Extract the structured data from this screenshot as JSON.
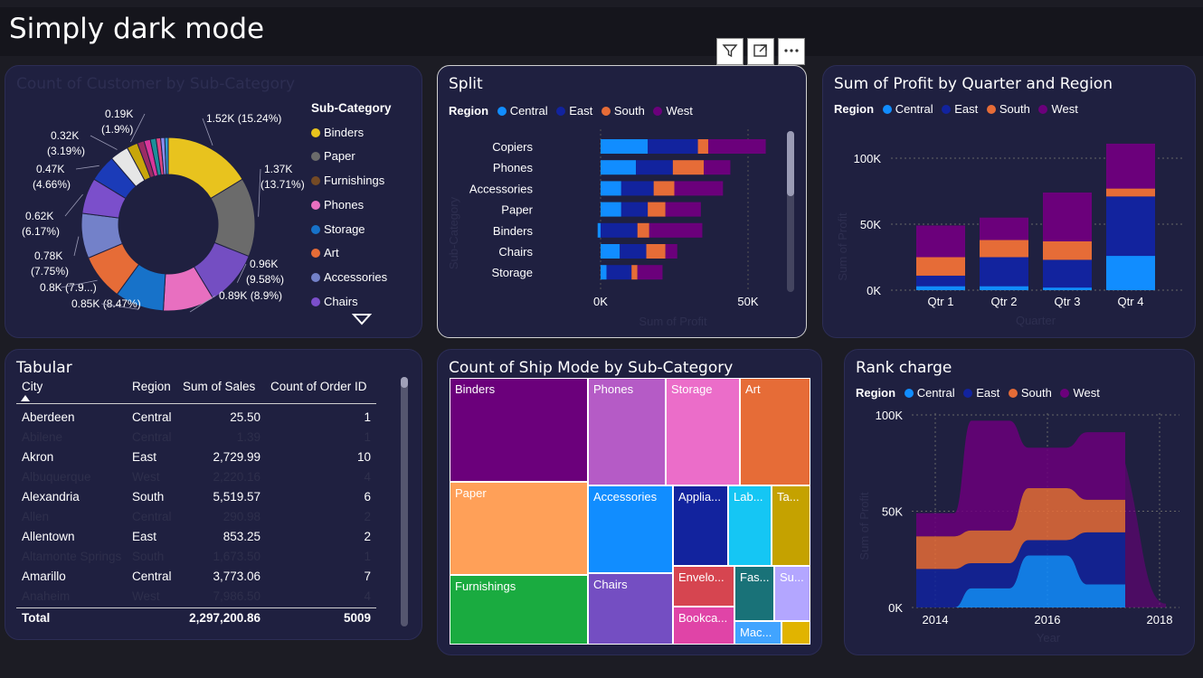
{
  "page": {
    "title": "Simply dark mode"
  },
  "toolbar": {
    "icons": [
      "filter-icon",
      "focus-mode-icon",
      "more-options-icon"
    ]
  },
  "colors": {
    "central": "#118DFF",
    "east": "#12239E",
    "south": "#E66C37",
    "west": "#6B007B"
  },
  "regions": [
    "Central",
    "East",
    "South",
    "West"
  ],
  "donut": {
    "title": "Count of Customer by Sub-Category",
    "legend_title": "Sub-Category",
    "legend_items": [
      "Binders",
      "Paper",
      "Furnishings",
      "Phones",
      "Storage",
      "Art",
      "Accessories",
      "Chairs"
    ],
    "labels": [
      {
        "l1": "1.52K (15.24%)",
        "l2": ""
      },
      {
        "l1": "1.37K",
        "l2": "(13.71%)"
      },
      {
        "l1": "0.96K",
        "l2": "(9.58%)"
      },
      {
        "l1": "0.89K (8.9%)",
        "l2": ""
      },
      {
        "l1": "0.85K (8.47%)",
        "l2": ""
      },
      {
        "l1": "0.8K (7.9...)",
        "l2": ""
      },
      {
        "l1": "0.78K",
        "l2": "(7.75%)"
      },
      {
        "l1": "0.62K",
        "l2": "(6.17%)"
      },
      {
        "l1": "0.47K",
        "l2": "(4.66%)"
      },
      {
        "l1": "0.32K",
        "l2": "(3.19%)"
      },
      {
        "l1": "0.19K",
        "l2": "(1.9%)"
      }
    ]
  },
  "split": {
    "title": "Split",
    "legend_title": "Region",
    "ylabel": "Sub-Category",
    "xlabel": "Sum of Profit",
    "xticks": [
      "0K",
      "50K"
    ]
  },
  "quarter": {
    "title": "Sum of Profit by Quarter and Region",
    "legend_title": "Region",
    "ylabel": "Sum of Profit",
    "xlabel": "Quarter",
    "yticks": [
      "0K",
      "50K",
      "100K"
    ]
  },
  "tabular": {
    "title": "Tabular",
    "headers": [
      "City",
      "Region",
      "Sum of Sales",
      "Count of Order ID"
    ],
    "rows": [
      {
        "city": "Aberdeen",
        "region": "Central",
        "sales": "25.50",
        "count": "1"
      },
      {
        "city": "Abilene",
        "region": "Central",
        "sales": "1.39",
        "count": "1"
      },
      {
        "city": "Akron",
        "region": "East",
        "sales": "2,729.99",
        "count": "10"
      },
      {
        "city": "Albuquerque",
        "region": "West",
        "sales": "2,220.16",
        "count": "4"
      },
      {
        "city": "Alexandria",
        "region": "South",
        "sales": "5,519.57",
        "count": "6"
      },
      {
        "city": "Allen",
        "region": "Central",
        "sales": "290.98",
        "count": "2"
      },
      {
        "city": "Allentown",
        "region": "East",
        "sales": "853.25",
        "count": "2"
      },
      {
        "city": "Altamonte Springs",
        "region": "South",
        "sales": "1,673.50",
        "count": "1"
      },
      {
        "city": "Amarillo",
        "region": "Central",
        "sales": "3,773.06",
        "count": "7"
      },
      {
        "city": "Anaheim",
        "region": "West",
        "sales": "7,986.50",
        "count": "4"
      }
    ],
    "total": {
      "label": "Total",
      "sales": "2,297,200.86",
      "count": "5009"
    }
  },
  "treemap": {
    "title": "Count of Ship Mode by Sub-Category",
    "tiles": [
      "Binders",
      "Paper",
      "Furnishings",
      "Phones",
      "Storage",
      "Art",
      "Accessories",
      "Chairs",
      "Applia...",
      "Lab...",
      "Ta...",
      "Envelo...",
      "Fas...",
      "Su...",
      "Bookca...",
      "Mac...",
      ""
    ]
  },
  "rank": {
    "title": "Rank charge",
    "legend_title": "Region",
    "ylabel": "Sum of Profit",
    "xlabel": "Year",
    "yticks": [
      "0K",
      "50K",
      "100K"
    ],
    "xticks": [
      "2014",
      "2016",
      "2018"
    ]
  },
  "chart_data": [
    {
      "type": "pie",
      "title": "Count of Customer by Sub-Category",
      "categories": [
        "Binders",
        "Paper",
        "Furnishings",
        "Phones",
        "Storage",
        "Art",
        "Accessories",
        "Chairs",
        "Labels",
        "Appliances",
        "Envelopes",
        "Bookcases",
        "Fasteners",
        "Supplies",
        "Machines",
        "Tables",
        "Copiers"
      ],
      "values": [
        1520,
        1370,
        960,
        890,
        850,
        800,
        780,
        620,
        470,
        320,
        190,
        120,
        110,
        100,
        80,
        70,
        60
      ],
      "colors": [
        "#E8C31E",
        "#6B6B6B",
        "#744EC2",
        "#E86FC0",
        "#1772C9",
        "#E66C37",
        "#7381C9",
        "#7B4FCB",
        "#1B3BB8",
        "#E6E6E6",
        "#C8A60A",
        "#9B2C64",
        "#D9369A",
        "#1C8F9A",
        "#E04884",
        "#8B8DF0",
        "#2E9BD6"
      ],
      "legend": "right"
    },
    {
      "type": "bar",
      "title": "Split",
      "orientation": "horizontal",
      "stacked": true,
      "categories": [
        "Copiers",
        "Phones",
        "Accessories",
        "Paper",
        "Binders",
        "Chairs",
        "Storage"
      ],
      "series": [
        {
          "name": "Central",
          "values": [
            16000,
            12000,
            7000,
            7000,
            -1000,
            6500,
            2000
          ]
        },
        {
          "name": "East",
          "values": [
            17000,
            12500,
            11000,
            9000,
            12500,
            9000,
            8500
          ]
        },
        {
          "name": "South",
          "values": [
            3500,
            10500,
            7000,
            6000,
            4000,
            6500,
            2000
          ]
        },
        {
          "name": "West",
          "values": [
            19500,
            9000,
            16500,
            12000,
            18000,
            4000,
            8500
          ]
        }
      ],
      "xlabel": "Sum of Profit",
      "ylabel": "Sub-Category",
      "xlim": [
        0,
        60000
      ],
      "legend": "top-left"
    },
    {
      "type": "bar",
      "title": "Sum of Profit by Quarter and Region",
      "stacked": true,
      "categories": [
        "Qtr 1",
        "Qtr 2",
        "Qtr 3",
        "Qtr 4"
      ],
      "series": [
        {
          "name": "Central",
          "values": [
            3000,
            3000,
            2000,
            26000
          ]
        },
        {
          "name": "East",
          "values": [
            8000,
            22000,
            21000,
            45000
          ]
        },
        {
          "name": "South",
          "values": [
            14000,
            13000,
            14000,
            6000
          ]
        },
        {
          "name": "West",
          "values": [
            24000,
            17000,
            37000,
            34000
          ]
        }
      ],
      "xlabel": "Quarter",
      "ylabel": "Sum of Profit",
      "ylim": [
        0,
        110000
      ],
      "legend": "top-left"
    },
    {
      "type": "area",
      "title": "Rank charge",
      "stacked": true,
      "x": [
        "2014",
        "2015",
        "2016",
        "2017"
      ],
      "series": [
        {
          "name": "Central",
          "values": [
            0,
            10000,
            27000,
            12000
          ]
        },
        {
          "name": "East",
          "values": [
            20000,
            13000,
            8000,
            27000
          ]
        },
        {
          "name": "South",
          "values": [
            17000,
            17000,
            27000,
            17000
          ]
        },
        {
          "name": "West",
          "values": [
            12000,
            57000,
            21000,
            35000
          ]
        }
      ],
      "xlabel": "Year",
      "ylabel": "Sum of Profit",
      "ylim": [
        0,
        100000
      ],
      "legend": "top-left"
    }
  ]
}
